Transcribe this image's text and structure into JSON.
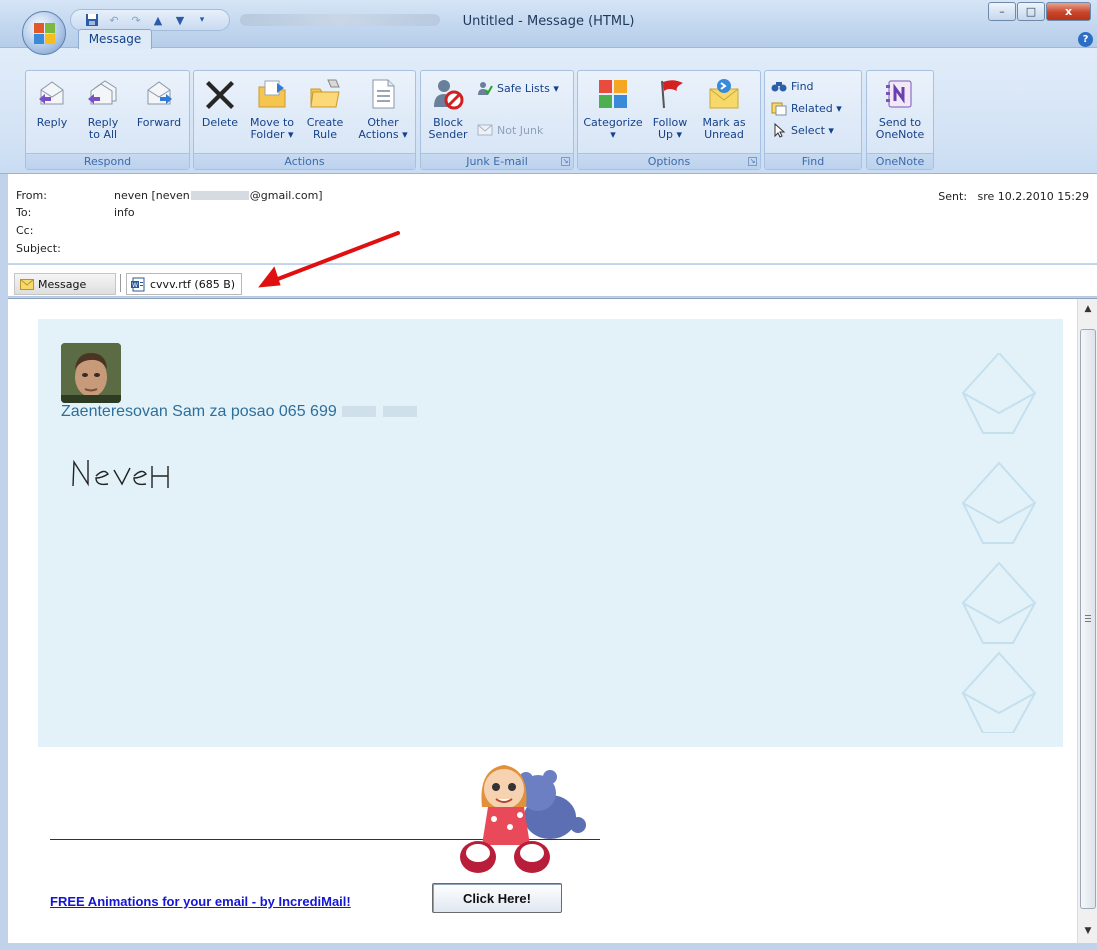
{
  "window": {
    "title": "Untitled - Message (HTML)",
    "minimize": "–",
    "maximize": "□",
    "close": "x",
    "help": "?"
  },
  "ribbon": {
    "tab": "Message",
    "respond": {
      "label": "Respond",
      "reply": "Reply",
      "reply_all_1": "Reply",
      "reply_all_2": "to All",
      "forward": "Forward"
    },
    "actions": {
      "label": "Actions",
      "delete": "Delete",
      "move_1": "Move to",
      "move_2": "Folder ▾",
      "create_1": "Create",
      "create_2": "Rule",
      "other_1": "Other",
      "other_2": "Actions ▾"
    },
    "junk": {
      "label": "Junk E-mail",
      "block_1": "Block",
      "block_2": "Sender",
      "safe_lists": "Safe Lists ▾",
      "not_junk": "Not Junk"
    },
    "options": {
      "label": "Options",
      "categorize": "Categorize",
      "follow_1": "Follow",
      "follow_2": "Up ▾",
      "mark_1": "Mark as",
      "mark_2": "Unread"
    },
    "find": {
      "label": "Find",
      "find": "Find",
      "related": "Related ▾",
      "select": "Select ▾"
    },
    "onenote": {
      "label": "OneNote",
      "send_1": "Send to",
      "send_2": "OneNote"
    }
  },
  "header": {
    "from_label": "From:",
    "from_value": "neven [neven",
    "from_value_end": "@gmail.com]",
    "to_label": "To:",
    "to_value": "info",
    "cc_label": "Cc:",
    "subject_label": "Subject:",
    "sent_label": "Sent:",
    "sent_value": "sre 10.2.2010 15:29"
  },
  "attachments": {
    "message_tab": "Message",
    "file": "cvvv.rtf (685 B)"
  },
  "body": {
    "greeting": "Zaenteresovan Sam za posao 065 699",
    "signature": "Neven",
    "promo_link": "FREE Animations for your email - by IncrediMail!",
    "click_button": "Click Here!"
  },
  "colors": {
    "ribbon_bg": "#d3e3f5",
    "card_bg": "#e3f2f8",
    "greeting": "#2e6f9a",
    "link": "#1515d6",
    "arrow": "#e01010"
  }
}
